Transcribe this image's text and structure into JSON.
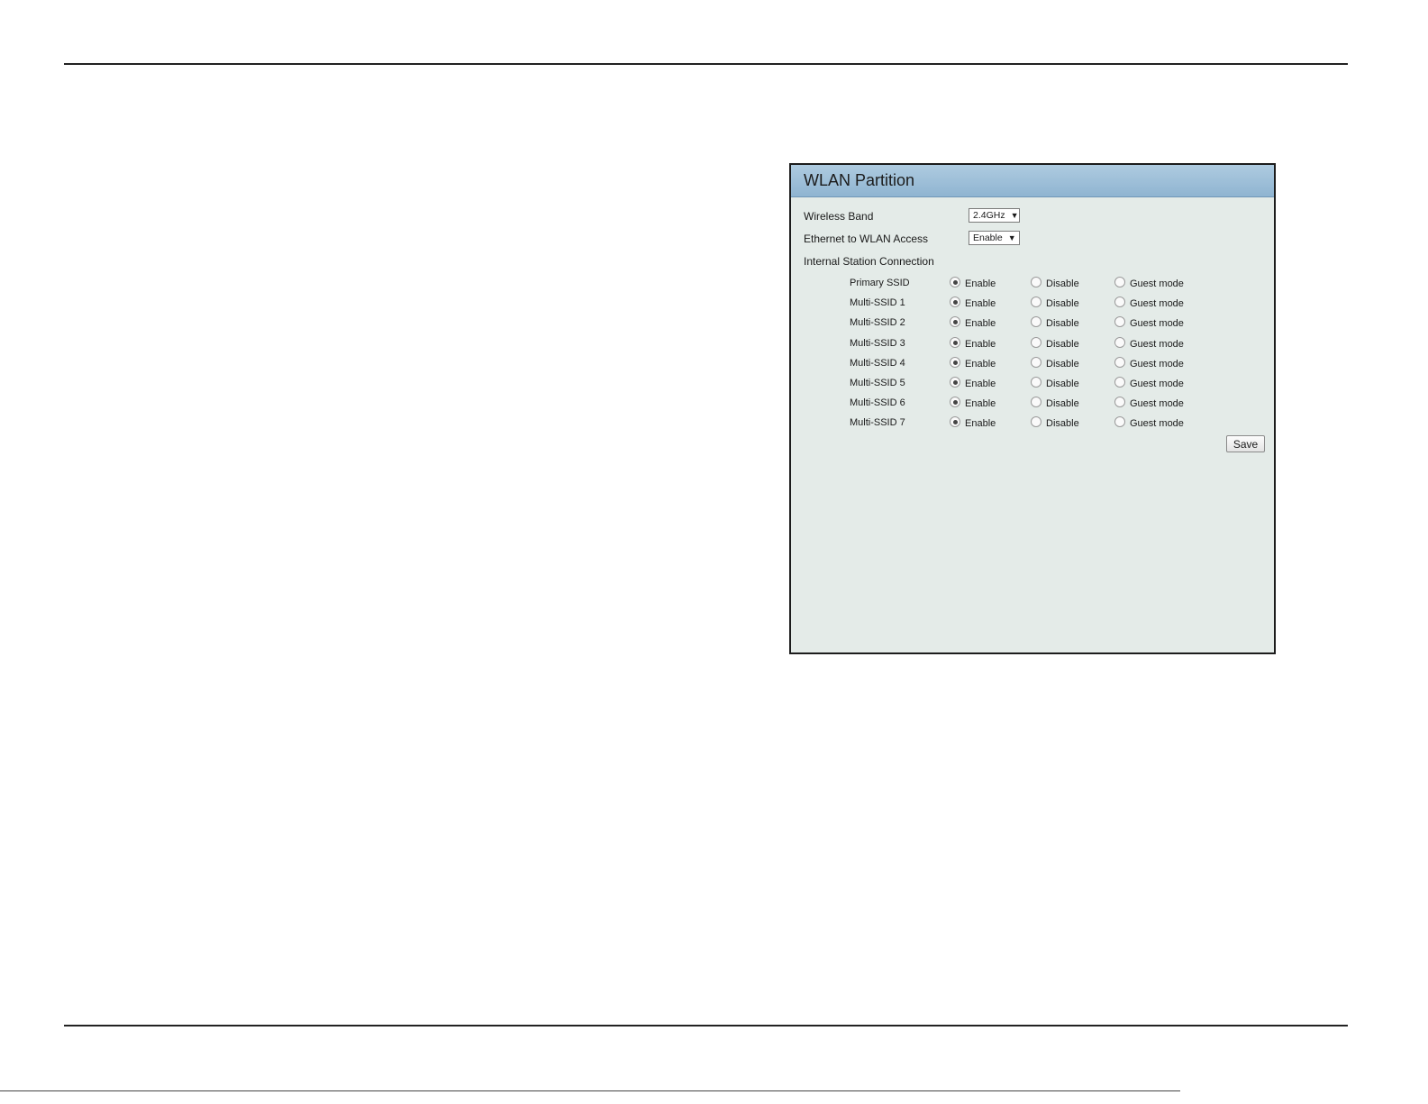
{
  "panel": {
    "title": "WLAN Partition",
    "wireless_band": {
      "label": "Wireless Band",
      "value": "2.4GHz"
    },
    "eth_access": {
      "label": "Ethernet to WLAN Access",
      "value": "Enable"
    },
    "isc_label": "Internal Station Connection",
    "options": {
      "enable": "Enable",
      "disable": "Disable",
      "guest": "Guest mode"
    },
    "rows": [
      {
        "name": "Primary SSID",
        "selected": "Enable"
      },
      {
        "name": "Multi-SSID 1",
        "selected": "Enable"
      },
      {
        "name": "Multi-SSID 2",
        "selected": "Enable"
      },
      {
        "name": "Multi-SSID 3",
        "selected": "Enable"
      },
      {
        "name": "Multi-SSID 4",
        "selected": "Enable"
      },
      {
        "name": "Multi-SSID 5",
        "selected": "Enable"
      },
      {
        "name": "Multi-SSID 6",
        "selected": "Enable"
      },
      {
        "name": "Multi-SSID 7",
        "selected": "Enable"
      }
    ],
    "save_label": "Save"
  }
}
